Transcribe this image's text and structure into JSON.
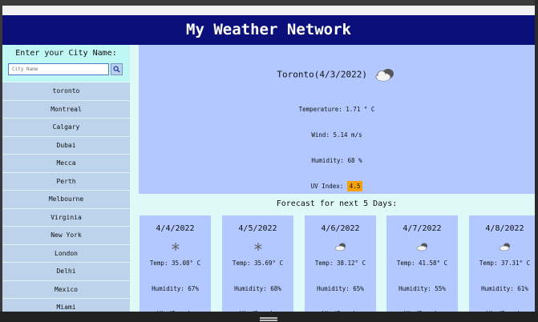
{
  "header": {
    "title": "My Weather Network"
  },
  "search": {
    "heading": "Enter your City Name:",
    "placeholder": "City Name"
  },
  "cities": [
    "toronto",
    "Montreal",
    "Calgary",
    "Dubai",
    "Mecca",
    "Perth",
    "Melbourne",
    "Virginia",
    "New York",
    "London",
    "Delhi",
    "Mexico",
    "Miami"
  ],
  "current": {
    "city_date": "Toronto(4/3/2022)",
    "icon": "cloudy-icon",
    "temperature": "Temperature: 1.71 ° C",
    "wind": "Wind: 5.14 m/s",
    "humidity": "Humidity: 68 %",
    "uv_label": "UV Index:",
    "uv_value": "4.5",
    "uv_color": "#f5a20a"
  },
  "forecast": {
    "title": "Forecast for next 5 Days:",
    "days": [
      {
        "date": "4/4/2022",
        "icon": "snow-icon",
        "temp": "Temp: 35.08° C",
        "humidity": "Humidity: 67%",
        "wind": "WindSpeed:"
      },
      {
        "date": "4/5/2022",
        "icon": "snow-icon",
        "temp": "Temp: 35.69° C",
        "humidity": "Humidity: 68%",
        "wind": "WindSpeed:"
      },
      {
        "date": "4/6/2022",
        "icon": "partly-cloudy-icon",
        "temp": "Temp: 38.12° C",
        "humidity": "Humidity: 65%",
        "wind": "WindSpeed:"
      },
      {
        "date": "4/7/2022",
        "icon": "partly-cloudy-icon",
        "temp": "Temp: 41.58° C",
        "humidity": "Humidity: 55%",
        "wind": "WindSpeed:"
      },
      {
        "date": "4/8/2022",
        "icon": "partly-cloudy-icon",
        "temp": "Temp: 37.31° C",
        "humidity": "Humidity: 61%",
        "wind": "WindSpeed:"
      }
    ]
  }
}
